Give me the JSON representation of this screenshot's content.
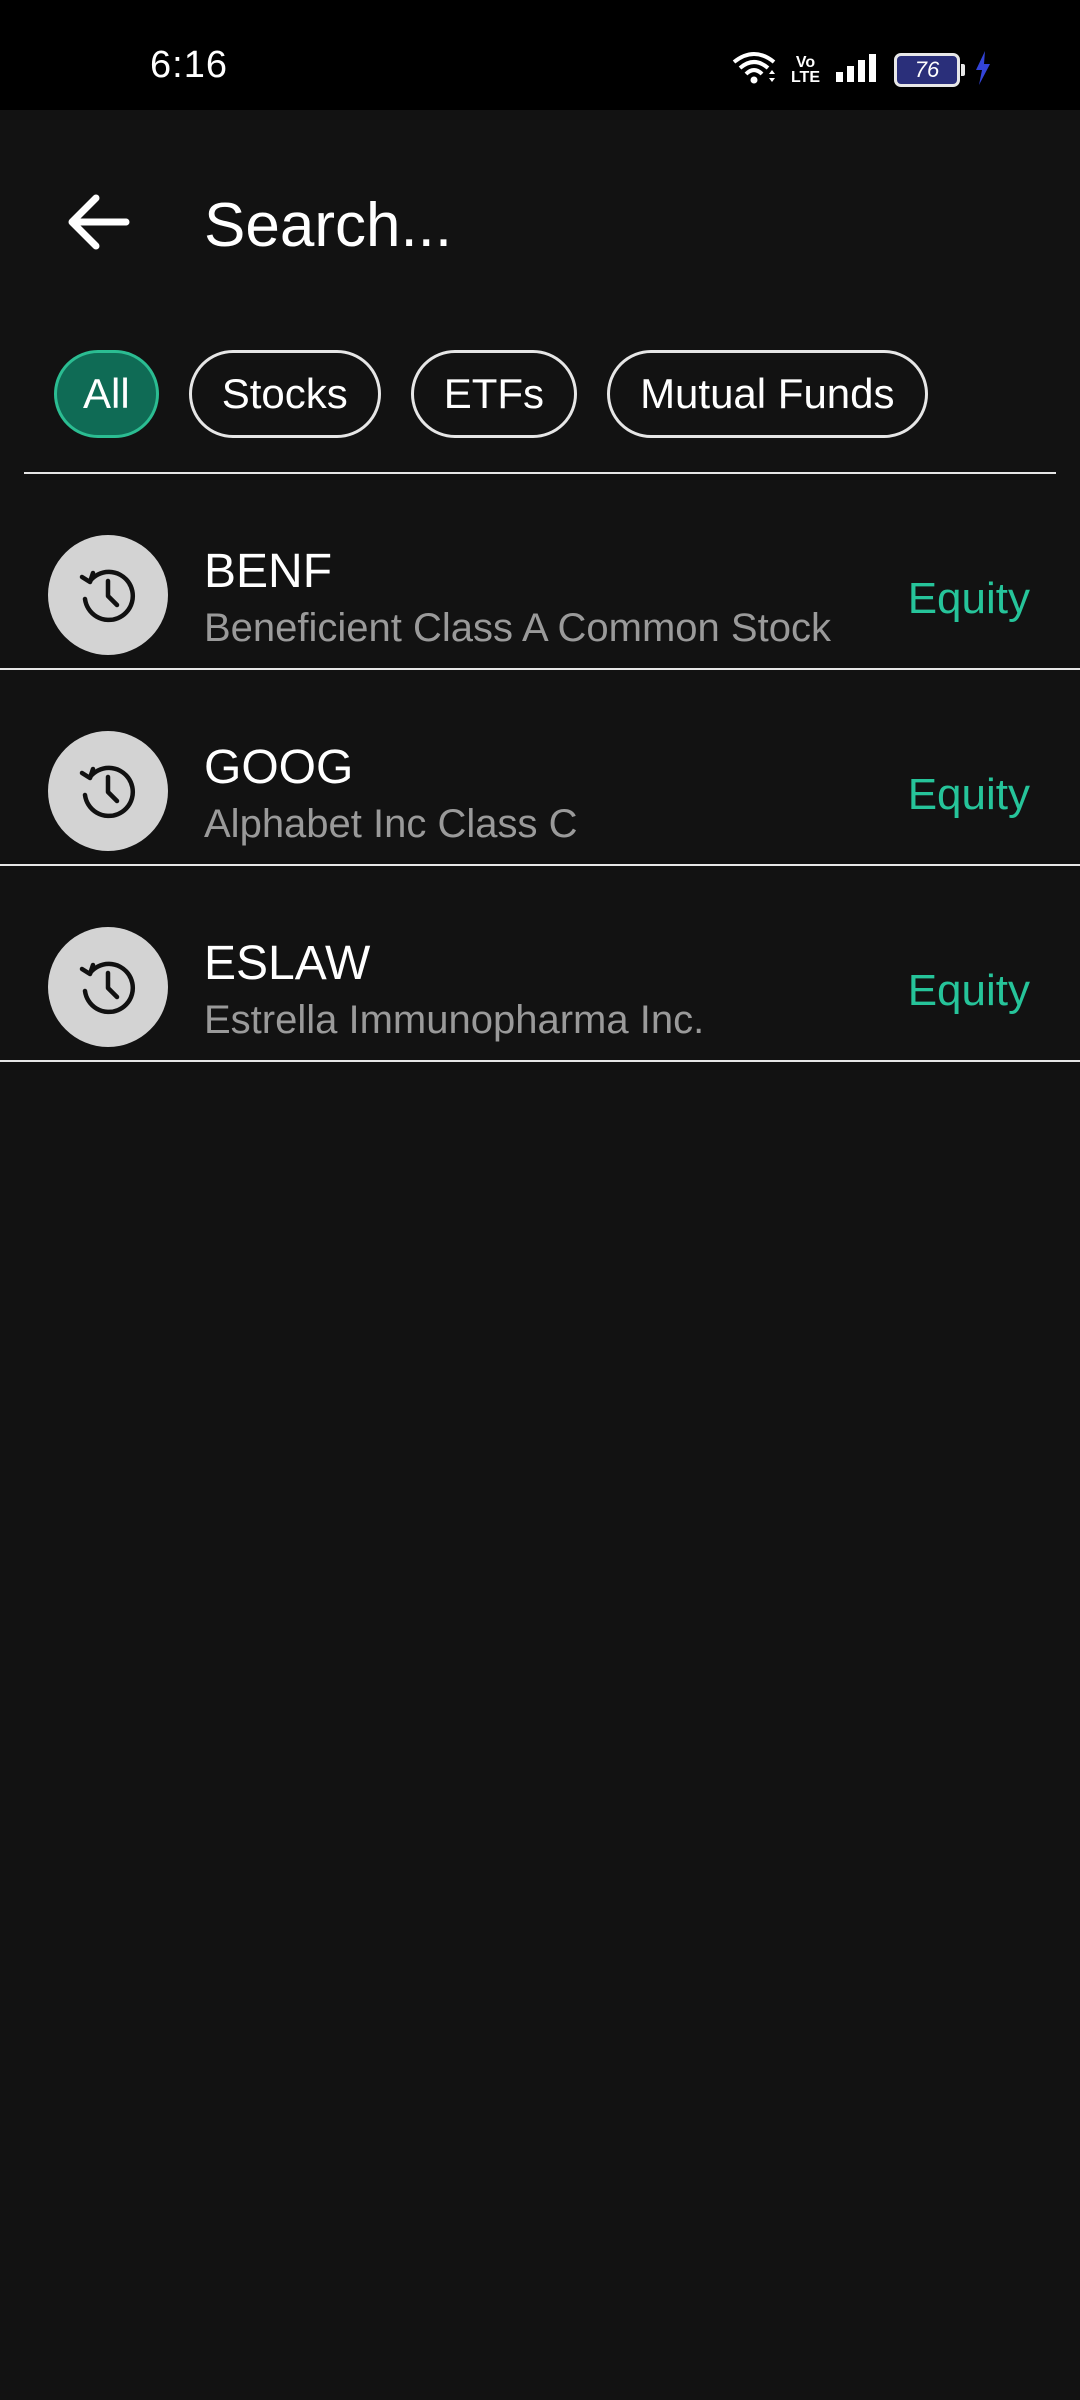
{
  "status_bar": {
    "time": "6:16",
    "battery_level": "76",
    "network_label_top": "Vo",
    "network_label_bottom": "LTE"
  },
  "header": {
    "search_placeholder": "Search..."
  },
  "filters": [
    {
      "label": "All",
      "active": true
    },
    {
      "label": "Stocks",
      "active": false
    },
    {
      "label": "ETFs",
      "active": false
    },
    {
      "label": "Mutual Funds",
      "active": false
    }
  ],
  "results": [
    {
      "symbol": "BENF",
      "name": "Beneficient Class A Common Stock",
      "type": "Equity"
    },
    {
      "symbol": "GOOG",
      "name": "Alphabet Inc Class C",
      "type": "Equity"
    },
    {
      "symbol": "ESLAW",
      "name": "Estrella Immunopharma Inc.",
      "type": "Equity"
    }
  ],
  "colors": {
    "background": "#121212",
    "accent": "#26c49a",
    "active_chip": "#0f6b55"
  }
}
